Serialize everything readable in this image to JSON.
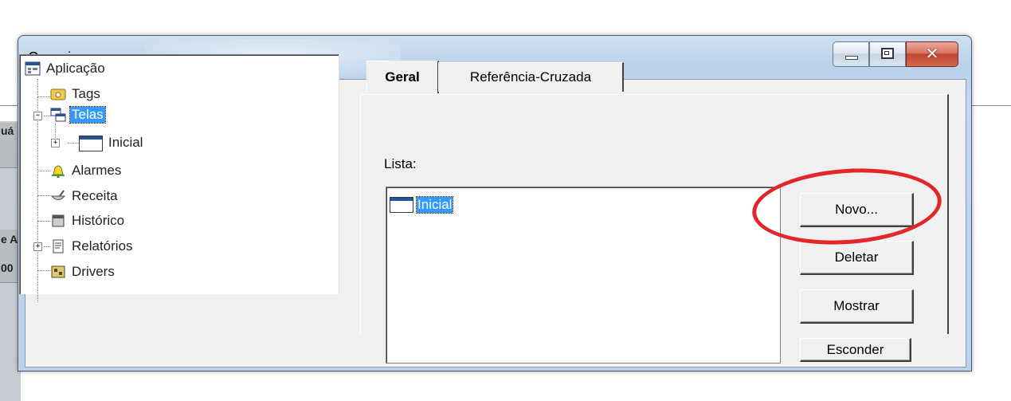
{
  "background": {
    "cells": [
      "uá",
      "e A",
      "00"
    ]
  },
  "dialog": {
    "title": "Organizer",
    "window_controls": {
      "minimize_icon": "minimize-icon",
      "maximize_icon": "maximize-icon",
      "close_icon": "close-icon"
    }
  },
  "tree": {
    "items": [
      {
        "label": "Aplicação",
        "icon": "application-icon",
        "selected": false
      },
      {
        "label": "Tags",
        "icon": "tags-icon",
        "selected": false
      },
      {
        "label": "Telas",
        "icon": "screens-icon",
        "selected": true,
        "expander": "−"
      },
      {
        "label": "Inicial",
        "icon": "window-icon",
        "selected": false,
        "expander": "+"
      },
      {
        "label": "Alarmes",
        "icon": "alarm-bell-icon",
        "selected": false
      },
      {
        "label": "Receita",
        "icon": "recipe-icon",
        "selected": false
      },
      {
        "label": "Histórico",
        "icon": "history-icon",
        "selected": false
      },
      {
        "label": "Relatórios",
        "icon": "reports-icon",
        "selected": false,
        "expander": "+"
      },
      {
        "label": "Drivers",
        "icon": "drivers-icon",
        "selected": false
      }
    ]
  },
  "tabs": [
    {
      "label": "Geral",
      "active": true
    },
    {
      "label": "Referência-Cruzada",
      "active": false
    }
  ],
  "main": {
    "lista_label": "Lista:",
    "list_items": [
      {
        "label": "Inicial",
        "icon": "window-icon",
        "selected": true
      }
    ],
    "buttons": {
      "novo": "Novo...",
      "deletar": "Deletar",
      "mostrar": "Mostrar",
      "esconder": "Esconder"
    }
  },
  "colors": {
    "selection": "#3399ff",
    "annotation_circle": "#e3262a",
    "close_button": "#c24531"
  }
}
